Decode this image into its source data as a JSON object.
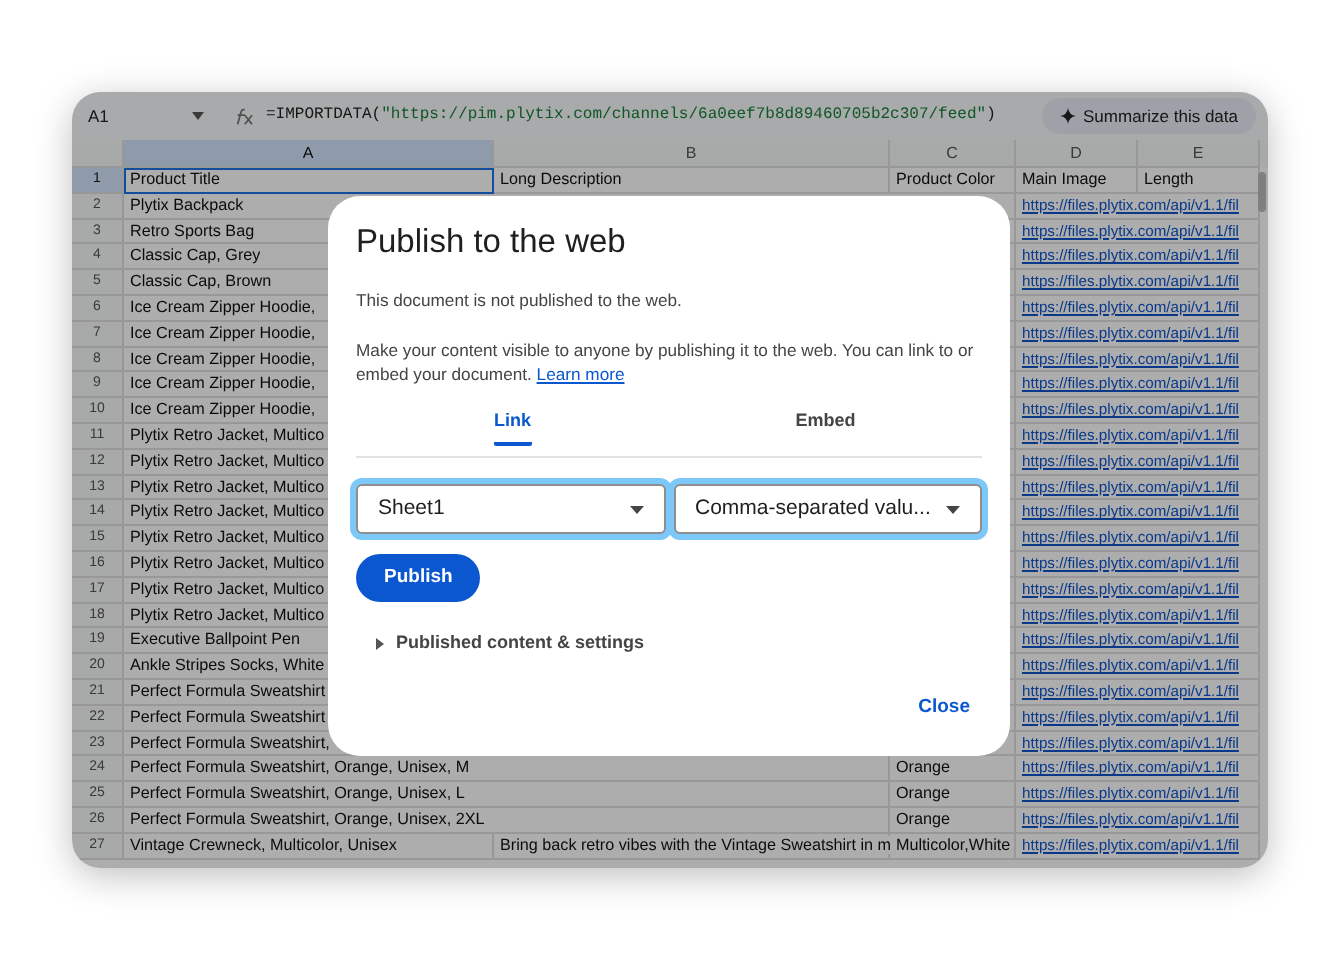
{
  "cell_reference": "A1",
  "formula": [
    {
      "kind": "code",
      "text": "=IMPORTDATA("
    },
    {
      "kind": "string",
      "text": "\"https://pim.plytix.com/channels/6a0eef7b8d89460705b2c307/feed\""
    },
    {
      "kind": "code",
      "text": ")"
    }
  ],
  "summarize_button": "Summarize this data",
  "sheet": {
    "columns": [
      {
        "label": "A",
        "selected": true
      },
      {
        "label": "B",
        "selected": false
      },
      {
        "label": "C",
        "selected": false
      },
      {
        "label": "D",
        "selected": false
      },
      {
        "label": "E",
        "selected": false
      }
    ],
    "rows": [
      {
        "number": "1",
        "selected": true,
        "col_a": "Product Title",
        "col_b": "Long Description",
        "col_c": "Product Color",
        "col_d": "Main Image",
        "col_e": "Length"
      },
      {
        "number": "2",
        "selected": false,
        "col_a": "Plytix Backpack",
        "col_d": {
          "kind": "link",
          "text": "https://files.plytix.com/api/v1.1/fil"
        }
      },
      {
        "number": "3",
        "selected": false,
        "col_a": "Retro Sports Bag",
        "col_d": {
          "kind": "link",
          "text": "https://files.plytix.com/api/v1.1/fil"
        }
      },
      {
        "number": "4",
        "selected": false,
        "col_a": "Classic Cap, Grey",
        "col_d": {
          "kind": "link",
          "text": "https://files.plytix.com/api/v1.1/fil"
        }
      },
      {
        "number": "5",
        "selected": false,
        "col_a": "Classic Cap, Brown",
        "col_d": {
          "kind": "link",
          "text": "https://files.plytix.com/api/v1.1/fil"
        }
      },
      {
        "number": "6",
        "selected": false,
        "col_a": "Ice Cream Zipper Hoodie,",
        "col_d": {
          "kind": "link",
          "text": "https://files.plytix.com/api/v1.1/fil"
        }
      },
      {
        "number": "7",
        "selected": false,
        "col_a": "Ice Cream Zipper Hoodie,",
        "col_d": {
          "kind": "link",
          "text": "https://files.plytix.com/api/v1.1/fil"
        }
      },
      {
        "number": "8",
        "selected": false,
        "col_a": "Ice Cream Zipper Hoodie,",
        "col_d": {
          "kind": "link",
          "text": "https://files.plytix.com/api/v1.1/fil"
        }
      },
      {
        "number": "9",
        "selected": false,
        "col_a": "Ice Cream Zipper Hoodie,",
        "col_d": {
          "kind": "link",
          "text": "https://files.plytix.com/api/v1.1/fil"
        }
      },
      {
        "number": "10",
        "selected": false,
        "col_a": "Ice Cream Zipper Hoodie,",
        "col_d": {
          "kind": "link",
          "text": "https://files.plytix.com/api/v1.1/fil"
        }
      },
      {
        "number": "11",
        "selected": false,
        "col_a": "Plytix Retro Jacket, Multico",
        "col_d": {
          "kind": "link",
          "text": "https://files.plytix.com/api/v1.1/fil"
        }
      },
      {
        "number": "12",
        "selected": false,
        "col_a": "Plytix Retro Jacket, Multico",
        "col_d": {
          "kind": "link",
          "text": "https://files.plytix.com/api/v1.1/fil"
        }
      },
      {
        "number": "13",
        "selected": false,
        "col_a": "Plytix Retro Jacket, Multico",
        "col_d": {
          "kind": "link",
          "text": "https://files.plytix.com/api/v1.1/fil"
        }
      },
      {
        "number": "14",
        "selected": false,
        "col_a": "Plytix Retro Jacket, Multico",
        "col_d": {
          "kind": "link",
          "text": "https://files.plytix.com/api/v1.1/fil"
        }
      },
      {
        "number": "15",
        "selected": false,
        "col_a": "Plytix Retro Jacket, Multico",
        "col_d": {
          "kind": "link",
          "text": "https://files.plytix.com/api/v1.1/fil"
        }
      },
      {
        "number": "16",
        "selected": false,
        "col_a": "Plytix Retro Jacket, Multico",
        "col_d": {
          "kind": "link",
          "text": "https://files.plytix.com/api/v1.1/fil"
        }
      },
      {
        "number": "17",
        "selected": false,
        "col_a": "Plytix Retro Jacket, Multico",
        "col_d": {
          "kind": "link",
          "text": "https://files.plytix.com/api/v1.1/fil"
        }
      },
      {
        "number": "18",
        "selected": false,
        "col_a": "Plytix Retro Jacket, Multico",
        "col_d": {
          "kind": "link",
          "text": "https://files.plytix.com/api/v1.1/fil"
        }
      },
      {
        "number": "19",
        "selected": false,
        "col_a": "Executive Ballpoint Pen",
        "col_d": {
          "kind": "link",
          "text": "https://files.plytix.com/api/v1.1/fil"
        }
      },
      {
        "number": "20",
        "selected": false,
        "col_a": "Ankle Stripes Socks, White",
        "col_d": {
          "kind": "link",
          "text": "https://files.plytix.com/api/v1.1/fil"
        }
      },
      {
        "number": "21",
        "selected": false,
        "col_a": "Perfect Formula Sweatshirt",
        "col_d": {
          "kind": "link",
          "text": "https://files.plytix.com/api/v1.1/fil"
        }
      },
      {
        "number": "22",
        "selected": false,
        "col_a": "Perfect Formula Sweatshirt",
        "col_d": {
          "kind": "link",
          "text": "https://files.plytix.com/api/v1.1/fil"
        }
      },
      {
        "number": "23",
        "selected": false,
        "col_a": "Perfect Formula Sweatshirt,",
        "col_d": {
          "kind": "link",
          "text": "https://files.plytix.com/api/v1.1/fil"
        }
      },
      {
        "number": "24",
        "selected": false,
        "col_a": "Perfect Formula Sweatshirt, Orange, Unisex, M",
        "col_c": "Orange",
        "col_d": {
          "kind": "link",
          "text": "https://files.plytix.com/api/v1.1/fil"
        }
      },
      {
        "number": "25",
        "selected": false,
        "col_a": "Perfect Formula Sweatshirt, Orange, Unisex, L",
        "col_c": "Orange",
        "col_d": {
          "kind": "link",
          "text": "https://files.plytix.com/api/v1.1/fil"
        }
      },
      {
        "number": "26",
        "selected": false,
        "col_a": "Perfect Formula Sweatshirt, Orange, Unisex, 2XL",
        "col_c": "Orange",
        "col_d": {
          "kind": "link",
          "text": "https://files.plytix.com/api/v1.1/fil"
        }
      },
      {
        "number": "27",
        "selected": false,
        "col_a": "Vintage Crewneck, Multicolor, Unisex",
        "col_b": "Bring back retro vibes with the Vintage Sweatshirt in m",
        "col_c": "Multicolor,White",
        "col_d": {
          "kind": "link",
          "text": "https://files.plytix.com/api/v1.1/fil"
        }
      }
    ]
  },
  "dialog": {
    "title": "Publish to the web",
    "status": "This document is not published to the web.",
    "description": "Make your content visible to anyone by publishing it to the web. You can link to or embed your document.",
    "learn_more": "Learn more",
    "tabs": [
      {
        "label": "Link",
        "selected": true
      },
      {
        "label": "Embed",
        "selected": false
      }
    ],
    "dropdowns": [
      {
        "value": "Sheet1",
        "highlighted": true
      },
      {
        "value": "Comma-separated valu...",
        "highlighted": true
      }
    ],
    "publish_button": "Publish",
    "settings_toggle": {
      "label": "Published content & settings",
      "expanded": false
    },
    "close_button": "Close"
  }
}
